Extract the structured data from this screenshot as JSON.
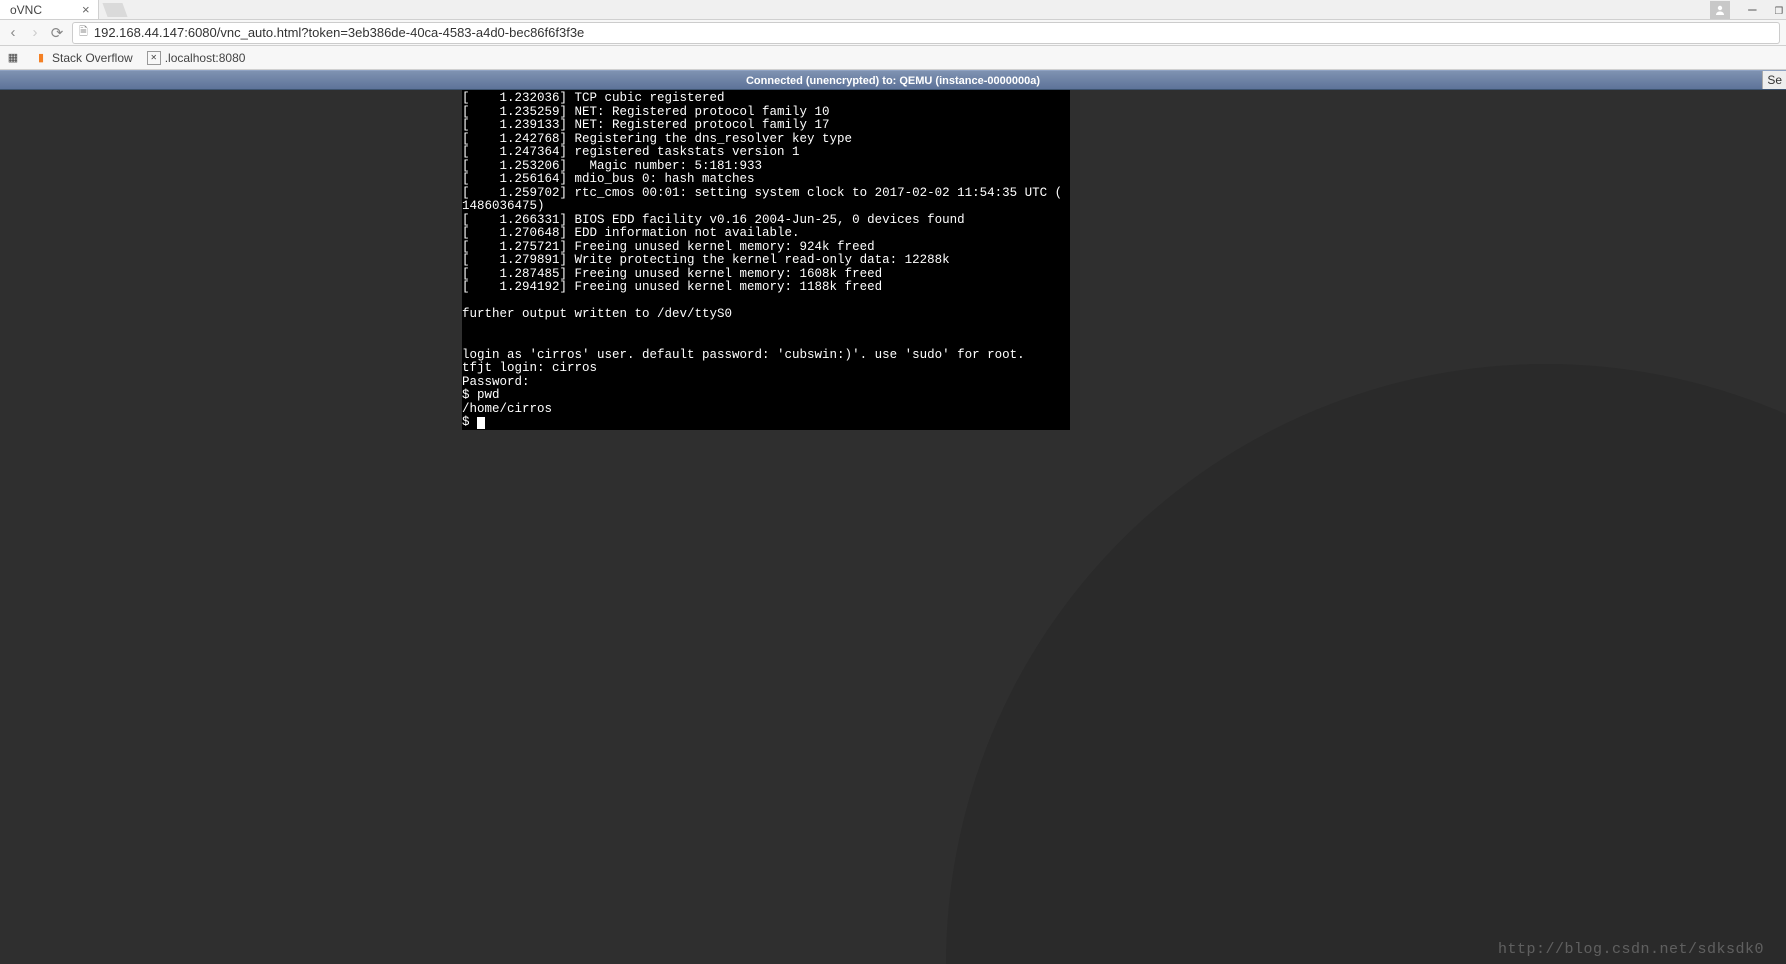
{
  "browser": {
    "tab_title": "oVNC",
    "url": "192.168.44.147:6080/vnc_auto.html?token=3eb386de-40ca-4583-a4d0-bec86f6f3f3e",
    "bookmarks": [
      {
        "label": "Stack Overflow"
      },
      {
        "label": ".localhost:8080"
      }
    ]
  },
  "vnc": {
    "status": "Connected (unencrypted) to: QEMU (instance-0000000a)",
    "button_right": "Se"
  },
  "terminal": {
    "lines": [
      "[    1.232036] TCP cubic registered",
      "[    1.235259] NET: Registered protocol family 10",
      "[    1.239133] NET: Registered protocol family 17",
      "[    1.242768] Registering the dns_resolver key type",
      "[    1.247364] registered taskstats version 1",
      "[    1.253206]   Magic number: 5:181:933",
      "[    1.256164] mdio_bus 0: hash matches",
      "[    1.259702] rtc_cmos 00:01: setting system clock to 2017-02-02 11:54:35 UTC (",
      "1486036475)",
      "[    1.266331] BIOS EDD facility v0.16 2004-Jun-25, 0 devices found",
      "[    1.270648] EDD information not available.",
      "[    1.275721] Freeing unused kernel memory: 924k freed",
      "[    1.279891] Write protecting the kernel read-only data: 12288k",
      "[    1.287485] Freeing unused kernel memory: 1608k freed",
      "[    1.294192] Freeing unused kernel memory: 1188k freed",
      "",
      "further output written to /dev/ttyS0",
      "",
      "",
      "login as 'cirros' user. default password: 'cubswin:)'. use 'sudo' for root.",
      "tfjt login: cirros",
      "Password:",
      "$ pwd",
      "/home/cirros",
      "$ "
    ]
  },
  "watermark": "http://blog.csdn.net/sdksdk0"
}
